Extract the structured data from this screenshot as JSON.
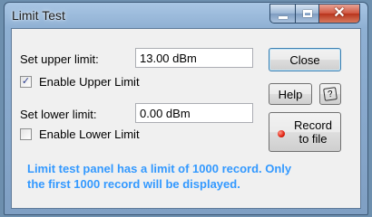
{
  "window": {
    "title": "Limit Test"
  },
  "upper": {
    "label": "Set upper limit:",
    "value": "13.00 dBm",
    "enable_label": "Enable Upper Limit",
    "enabled": true
  },
  "lower": {
    "label": "Set lower limit:",
    "value": "0.00 dBm",
    "enable_label": "Enable Lower Limit",
    "enabled": false
  },
  "buttons": {
    "close": "Close",
    "help": "Help",
    "record_line1": "Record",
    "record_line2": "to file"
  },
  "note": "Limit test panel has a limit of 1000 record. Only the first 1000 record will be displayed.",
  "colors": {
    "note": "#3399ff",
    "led": "#e01e0e"
  },
  "icons": {
    "context_help": "question-icon",
    "record": "red-led-icon"
  }
}
